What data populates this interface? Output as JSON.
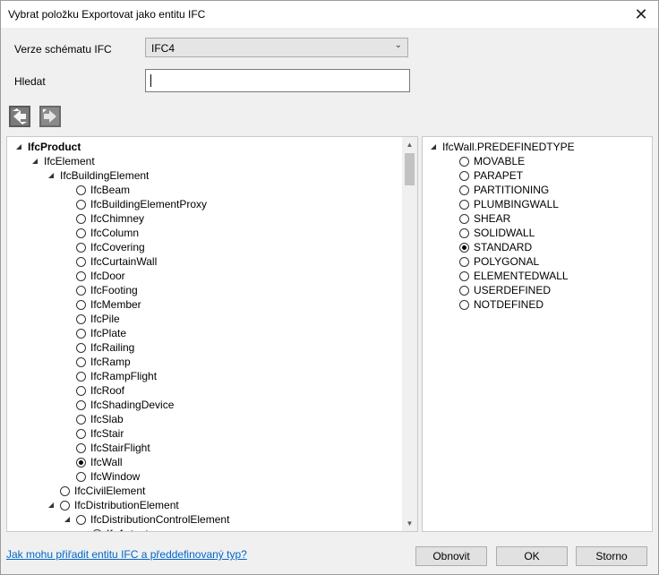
{
  "window": {
    "title": "Vybrat položku Exportovat jako entitu IFC",
    "close_glyph": "✕"
  },
  "form": {
    "schema_label": "Verze schématu IFC",
    "schema_value": "IFC4",
    "search_label": "Hledat",
    "search_value": ""
  },
  "toolbar": {
    "expand_icon": "expand-all-icon",
    "collapse_icon": "collapse-all-icon"
  },
  "left_tree": [
    {
      "label": "IfcProduct",
      "level": 0,
      "expander": "open",
      "radio": false,
      "bold": true
    },
    {
      "label": "IfcElement",
      "level": 1,
      "expander": "open",
      "radio": false
    },
    {
      "label": "IfcBuildingElement",
      "level": 2,
      "expander": "open",
      "radio": false
    },
    {
      "label": "IfcBeam",
      "level": 3,
      "radio": true
    },
    {
      "label": "IfcBuildingElementProxy",
      "level": 3,
      "radio": true
    },
    {
      "label": "IfcChimney",
      "level": 3,
      "radio": true
    },
    {
      "label": "IfcColumn",
      "level": 3,
      "radio": true
    },
    {
      "label": "IfcCovering",
      "level": 3,
      "radio": true
    },
    {
      "label": "IfcCurtainWall",
      "level": 3,
      "radio": true
    },
    {
      "label": "IfcDoor",
      "level": 3,
      "radio": true
    },
    {
      "label": "IfcFooting",
      "level": 3,
      "radio": true
    },
    {
      "label": "IfcMember",
      "level": 3,
      "radio": true
    },
    {
      "label": "IfcPile",
      "level": 3,
      "radio": true
    },
    {
      "label": "IfcPlate",
      "level": 3,
      "radio": true
    },
    {
      "label": "IfcRailing",
      "level": 3,
      "radio": true
    },
    {
      "label": "IfcRamp",
      "level": 3,
      "radio": true
    },
    {
      "label": "IfcRampFlight",
      "level": 3,
      "radio": true
    },
    {
      "label": "IfcRoof",
      "level": 3,
      "radio": true
    },
    {
      "label": "IfcShadingDevice",
      "level": 3,
      "radio": true
    },
    {
      "label": "IfcSlab",
      "level": 3,
      "radio": true
    },
    {
      "label": "IfcStair",
      "level": 3,
      "radio": true
    },
    {
      "label": "IfcStairFlight",
      "level": 3,
      "radio": true
    },
    {
      "label": "IfcWall",
      "level": 3,
      "radio": true,
      "checked": true
    },
    {
      "label": "IfcWindow",
      "level": 3,
      "radio": true
    },
    {
      "label": "IfcCivilElement",
      "level": 2,
      "radio": true
    },
    {
      "label": "IfcDistributionElement",
      "level": 2,
      "expander": "open",
      "radio": true
    },
    {
      "label": "IfcDistributionControlElement",
      "level": 3,
      "expander": "open",
      "radio": true
    },
    {
      "label": "IfcActuator",
      "level": 4,
      "radio": true
    }
  ],
  "right_tree": {
    "root": "IfcWall.PREDEFINEDTYPE",
    "items": [
      {
        "label": "MOVABLE",
        "checked": false
      },
      {
        "label": "PARAPET",
        "checked": false
      },
      {
        "label": "PARTITIONING",
        "checked": false
      },
      {
        "label": "PLUMBINGWALL",
        "checked": false
      },
      {
        "label": "SHEAR",
        "checked": false
      },
      {
        "label": "SOLIDWALL",
        "checked": false
      },
      {
        "label": "STANDARD",
        "checked": true
      },
      {
        "label": "POLYGONAL",
        "checked": false
      },
      {
        "label": "ELEMENTEDWALL",
        "checked": false
      },
      {
        "label": "USERDEFINED",
        "checked": false
      },
      {
        "label": "NOTDEFINED",
        "checked": false
      }
    ]
  },
  "footer": {
    "help_link": "Jak mohu přiřadit entitu IFC a předdefinovaný typ?",
    "refresh_label": "Obnovit",
    "ok_label": "OK",
    "cancel_label": "Storno"
  }
}
